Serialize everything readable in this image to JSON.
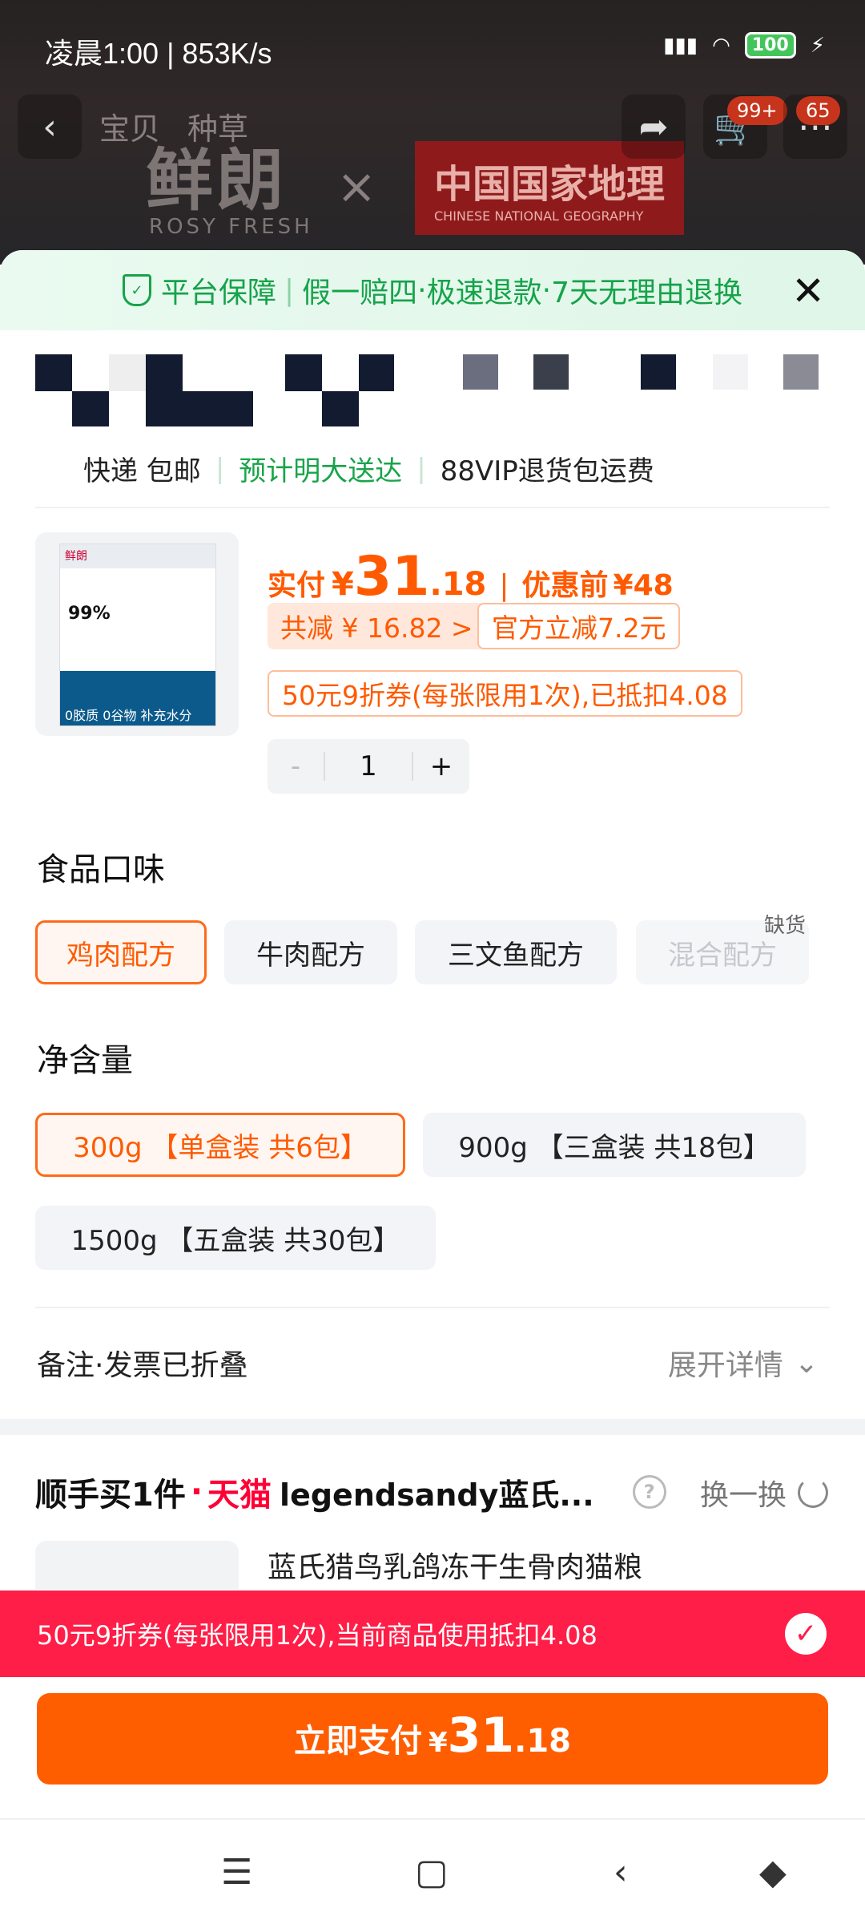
{
  "status_bar": {
    "time_speed": "凌晨1:00 | 853K/s",
    "battery": "100"
  },
  "background_page": {
    "tab_item": "宝贝",
    "tab_note": "种草",
    "brand_left": "鲜朗",
    "brand_left_sub": "ROSY FRESH",
    "times": "×",
    "brand_right": "中国国家地理",
    "brand_right_sub": "CHINESE NATIONAL GEOGRAPHY",
    "cart_badge": "99+",
    "msg_badge": "65"
  },
  "guarantee": {
    "label": "平台保障",
    "items": [
      "假一赔四",
      "极速退款",
      "7天无理由退换"
    ]
  },
  "shipping": {
    "express": "快递 包邮",
    "eta": "预计明大送达",
    "vip": "88VIP退货包运费"
  },
  "product": {
    "thumb_brand": "鲜朗",
    "thumb_pct": "99%",
    "thumb_caption": "0胶质 0谷物 补充水分",
    "pay_label": "实付",
    "currency": "¥",
    "price_int": "31",
    "price_dec": ".18",
    "orig_label": "优惠前",
    "orig_price": "¥48",
    "discount_total": "共减 ¥ 16.82 >",
    "official_discount": "官方立减7.2元",
    "coupon_note": "50元9折券(每张限用1次),已抵扣4.08",
    "quantity": "1",
    "minus": "-",
    "plus": "+"
  },
  "flavor": {
    "title": "食品口味",
    "options": [
      "鸡肉配方",
      "牛肉配方",
      "三文鱼配方",
      "混合配方"
    ],
    "selected": "鸡肉配方",
    "out_of_stock_label": "缺货"
  },
  "net_content": {
    "title": "净含量",
    "options": [
      "300g 【单盒装 共6包】",
      "900g 【三盒装 共18包】",
      "1500g 【五盒装 共30包】"
    ],
    "selected": "300g 【单盒装 共6包】"
  },
  "remarks": {
    "label": "备注·发票已折叠",
    "expand": "展开详情"
  },
  "add_on": {
    "title": "顺手买1件",
    "dot": "·",
    "platform": "天猫",
    "store": "legendsandy蓝氏...",
    "help": "?",
    "swap": "换一换",
    "item_name": "蓝氏猎鸟乳鸽冻干生骨肉猫粮"
  },
  "coupon_bar": {
    "text": "50元9折券(每张限用1次),当前商品使用抵扣4.08",
    "check": "✓"
  },
  "pay_button": {
    "label": "立即支付",
    "currency": "¥",
    "int": "31",
    "dec": ".18"
  },
  "colors": {
    "accent": "#ff5e00",
    "green": "#16a34a",
    "red": "#ff1e47"
  }
}
